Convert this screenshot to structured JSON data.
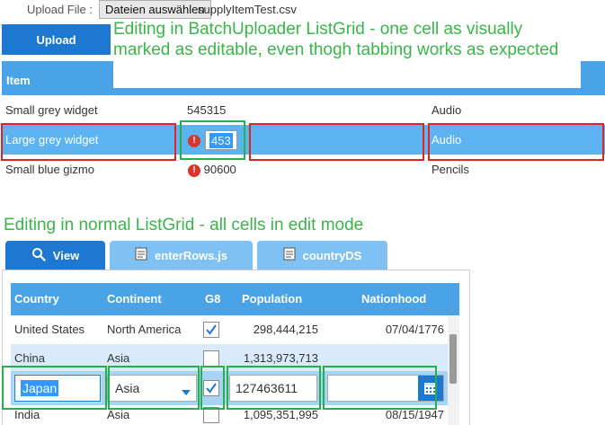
{
  "upload": {
    "label": "Upload File :",
    "choose_button": "Dateien auswählen",
    "file_name": "supplyItemTest.csv",
    "upload_button": "Upload"
  },
  "annotations": {
    "top": "Editing in BatchUploader ListGrid - one cell as visually marked as editable, even thogh tabbing works as expected",
    "middle": "Editing in normal ListGrid - all cells in edit mode"
  },
  "batch_grid": {
    "header": "Item",
    "rows": [
      {
        "item": "Small grey widget",
        "value": "545315",
        "category": "Audio",
        "error": false
      },
      {
        "item": "Large grey widget",
        "value": "453",
        "category": "Audio",
        "error": true
      },
      {
        "item": "Small blue gizmo",
        "value": "90600",
        "category": "Pencils",
        "error": true
      }
    ],
    "error_glyph": "!"
  },
  "tabs": [
    {
      "label": "View",
      "icon": "search-icon"
    },
    {
      "label": "enterRows.js",
      "icon": "document-icon"
    },
    {
      "label": "countryDS",
      "icon": "document-icon"
    }
  ],
  "country_grid": {
    "headers": [
      "Country",
      "Continent",
      "G8",
      "Population",
      "Nationhood"
    ],
    "rows": [
      {
        "country": "United States",
        "continent": "North America",
        "g8": true,
        "population": "298,444,215",
        "nationhood": "07/04/1776"
      },
      {
        "country": "China",
        "continent": "Asia",
        "g8": false,
        "population": "1,313,973,713",
        "nationhood": ""
      },
      {
        "country": "India",
        "continent": "Asia",
        "g8": false,
        "population": "1,095,351,995",
        "nationhood": "08/15/1947"
      }
    ],
    "edit_row": {
      "country": "Japan",
      "continent": "Asia",
      "g8": true,
      "population": "127463611",
      "nationhood": ""
    }
  },
  "colors": {
    "accent": "#1c78d1",
    "header": "#4aa3e6",
    "annotation_green": "#39b54a",
    "marker_red": "#e02424",
    "marker_green": "#22b14c"
  }
}
